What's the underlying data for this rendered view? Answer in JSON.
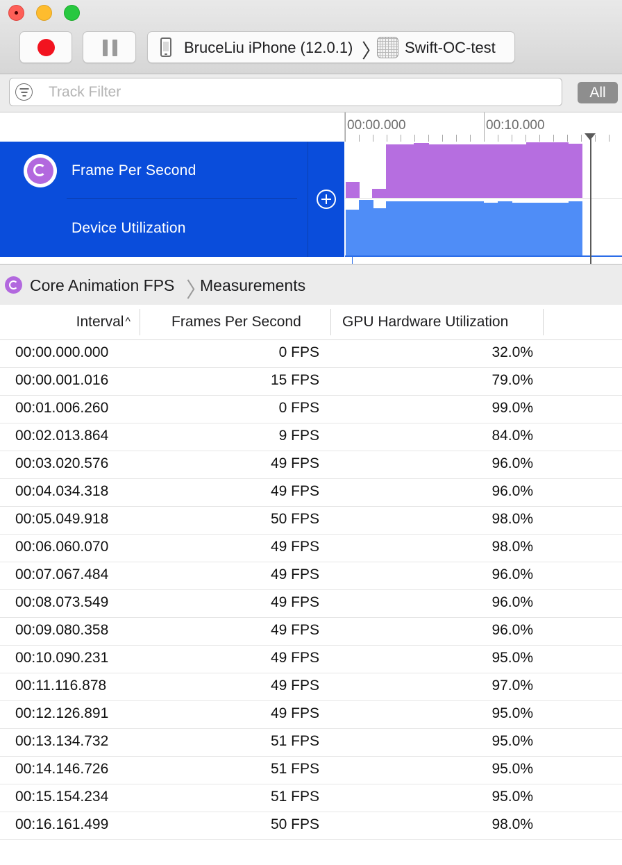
{
  "window": {
    "record_button": "record",
    "pause_button": "pause"
  },
  "toolbar": {
    "device": "BruceLiu iPhone (12.0.1)",
    "separator": "〉",
    "app": "Swift-OC-test"
  },
  "filter": {
    "placeholder": "Track Filter",
    "value": "",
    "scope_button": "All"
  },
  "timeline": {
    "ruler_labels": [
      "00:00.000",
      "00:10.000"
    ]
  },
  "tracks": [
    {
      "label": "Frame Per Second",
      "color": "#b66ee0"
    },
    {
      "label": "Device Utilization",
      "color": "#4f8df7"
    }
  ],
  "breadcrumb": {
    "instrument": "Core Animation FPS",
    "separator": "〉",
    "view": "Measurements"
  },
  "table": {
    "columns": [
      "Interval",
      "Frames Per Second",
      "GPU Hardware Utilization"
    ],
    "sort_indicator": "^",
    "rows": [
      [
        "00:00.000.000",
        "0 FPS",
        "32.0%"
      ],
      [
        "00:00.001.016",
        "15 FPS",
        "79.0%"
      ],
      [
        "00:01.006.260",
        "0 FPS",
        "99.0%"
      ],
      [
        "00:02.013.864",
        "9 FPS",
        "84.0%"
      ],
      [
        "00:03.020.576",
        "49 FPS",
        "96.0%"
      ],
      [
        "00:04.034.318",
        "49 FPS",
        "96.0%"
      ],
      [
        "00:05.049.918",
        "50 FPS",
        "98.0%"
      ],
      [
        "00:06.060.070",
        "49 FPS",
        "98.0%"
      ],
      [
        "00:07.067.484",
        "49 FPS",
        "96.0%"
      ],
      [
        "00:08.073.549",
        "49 FPS",
        "96.0%"
      ],
      [
        "00:09.080.358",
        "49 FPS",
        "96.0%"
      ],
      [
        "00:10.090.231",
        "49 FPS",
        "95.0%"
      ],
      [
        "00:11.116.878",
        "49 FPS",
        "97.0%"
      ],
      [
        "00:12.126.891",
        "49 FPS",
        "95.0%"
      ],
      [
        "00:13.134.732",
        "51 FPS",
        "95.0%"
      ],
      [
        "00:14.146.726",
        "51 FPS",
        "95.0%"
      ],
      [
        "00:15.154.234",
        "51 FPS",
        "95.0%"
      ],
      [
        "00:16.161.499",
        "50 FPS",
        "98.0%"
      ]
    ]
  }
}
